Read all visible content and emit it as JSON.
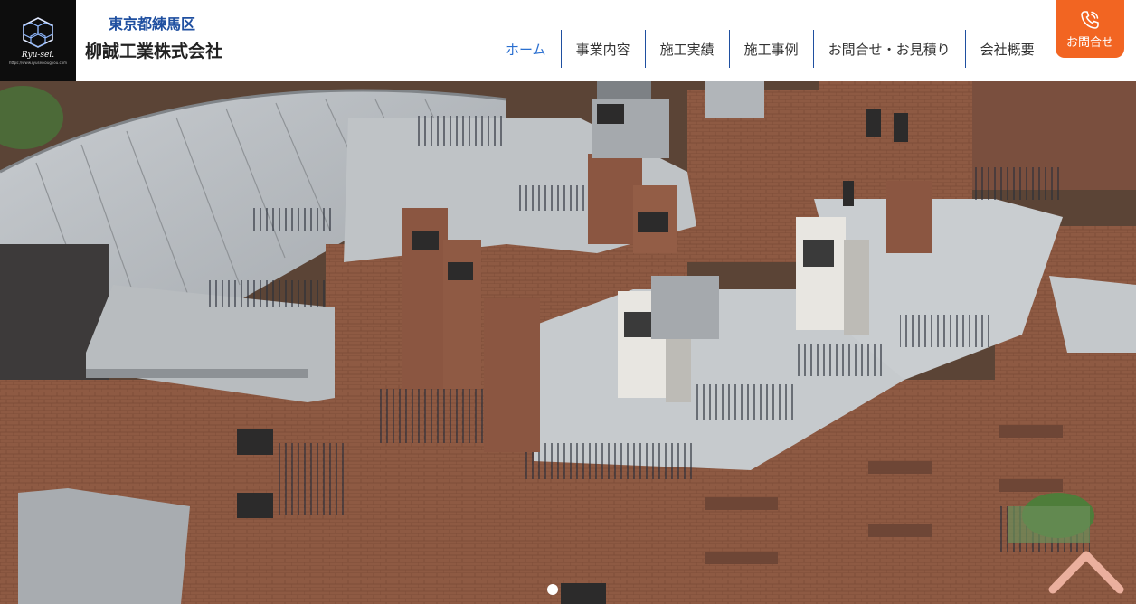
{
  "header": {
    "logo_text": "Ryu-sei.",
    "logo_url": "https://www.ryuseikougyou.com",
    "location": "東京都練馬区",
    "company_name": "柳誠工業株式会社"
  },
  "nav": {
    "items": [
      {
        "label": "ホーム",
        "active": true
      },
      {
        "label": "事業内容"
      },
      {
        "label": "施工実績"
      },
      {
        "label": "施工事例"
      },
      {
        "label": "お問合せ・お見積り"
      },
      {
        "label": "会社概要"
      }
    ]
  },
  "contact": {
    "label": "お問合せ",
    "icon": "phone-icon"
  },
  "hero": {
    "slide_count": 1,
    "active_slide": 1
  },
  "colors": {
    "accent": "#f26522",
    "nav_divider": "#1f4fa0",
    "active_nav": "#2a6fd0",
    "location_text": "#1f4fa0"
  }
}
